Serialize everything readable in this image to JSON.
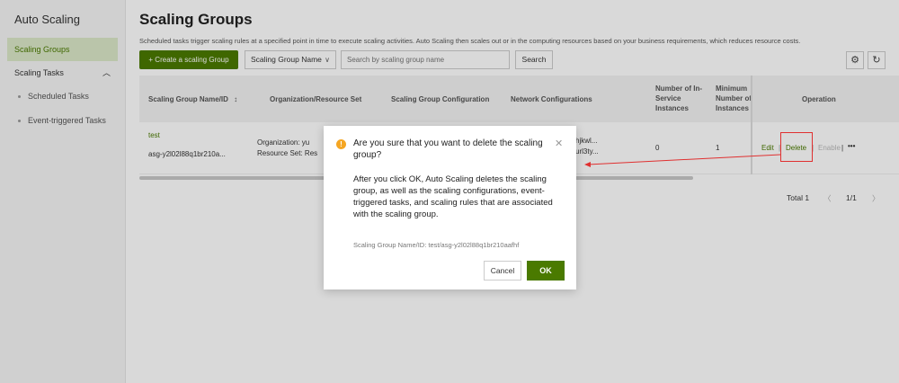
{
  "sidebar": {
    "title": "Auto Scaling",
    "items": [
      {
        "label": "Scaling Groups"
      },
      {
        "label": "Scaling Tasks"
      }
    ],
    "sub_items": [
      {
        "label": "Scheduled Tasks"
      },
      {
        "label": "Event-triggered Tasks"
      }
    ]
  },
  "page": {
    "title": "Scaling Groups",
    "description": "Scheduled tasks trigger scaling rules at a specified point in time to execute scaling activities. Auto Scaling then scales out or in the computing resources based on your business requirements, which reduces resource costs."
  },
  "toolbar": {
    "create_label": "+ Create a scaling Group",
    "filter_select": "Scaling Group Name",
    "search_placeholder": "Search by scaling group name",
    "search_label": "Search"
  },
  "table": {
    "columns": {
      "name": "Scaling Group Name/ID",
      "org": "Organization/Resource Set",
      "config": "Scaling Group Configuration",
      "network": "Network Configurations",
      "inservice": "Number of In-Service Instances",
      "minimum": "Minimum Number of Instances",
      "operation": "Operation"
    },
    "rows": [
      {
        "name": "test",
        "id": "asg-y2l02l88q1br210a...",
        "org": "Organization: yu",
        "resource_set": "Resource Set: Res",
        "network_1": "hjkwl...",
        "network_2": "url3ty...",
        "inservice": "0",
        "minimum": "1",
        "edit": "Edit",
        "delete": "Delete",
        "enable": "Enable",
        "more": "•••"
      }
    ]
  },
  "pagination": {
    "total": "Total 1",
    "pages": "1/1"
  },
  "dialog": {
    "title": "Are you sure that you want to delete the scaling group?",
    "body": "After you click OK, Auto Scaling deletes the scaling group, as well as the scaling configurations, event-triggered tasks, and scaling rules that are associated with the scaling group.",
    "meta": "Scaling Group Name/ID: test/asg-y2l02l88q1br210aafhf",
    "cancel_label": "Cancel",
    "ok_label": "OK"
  },
  "colors": {
    "accent": "#4a7a00",
    "annotation": "#e03030",
    "warning": "#f5a623"
  }
}
